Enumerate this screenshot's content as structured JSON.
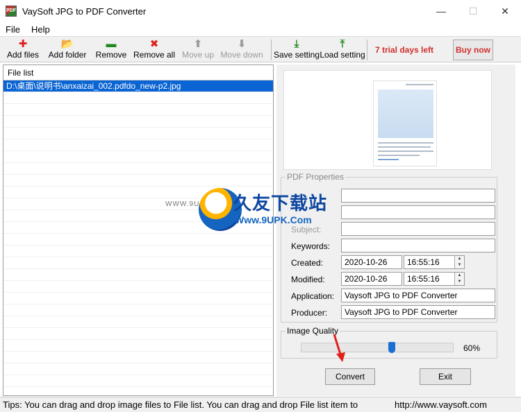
{
  "window": {
    "title": "VaySoft JPG to PDF Converter",
    "app_icon_text": "PDF",
    "minimize": "—",
    "maximize": "☐",
    "close": "✕"
  },
  "menu": {
    "items": [
      "File",
      "Help"
    ]
  },
  "toolbar": {
    "add_files": "Add files",
    "add_folder": "Add folder",
    "remove": "Remove",
    "remove_all": "Remove all",
    "move_up": "Move up",
    "move_down": "Move down",
    "save_setting": "Save setting",
    "load_setting": "Load setting",
    "trial": "7 trial days left",
    "buy_now": "Buy now",
    "colors": {
      "add": "#e02020",
      "remove": "#1e8a1e",
      "remove_all": "#e02020",
      "disabled": "#9a9a9a",
      "setting": "#1e8a1e"
    }
  },
  "file_list": {
    "header": "File list",
    "items": [
      "D:\\桌面\\说明书\\anxaizai_002.pdfdo_new-p2.jpg"
    ]
  },
  "preview": {},
  "pdf_properties": {
    "title": "PDF Properties",
    "subject_label": "Subject:",
    "keywords_label": "Keywords:",
    "created_label": "Created:",
    "created_date": "2020-10-26",
    "created_time": "16:55:16",
    "modified_label": "Modified:",
    "modified_date": "2020-10-26",
    "modified_time": "16:55:16",
    "application_label": "Application:",
    "application_value": "Vaysoft JPG to PDF Converter",
    "producer_label": "Producer:",
    "producer_value": "Vaysoft JPG to PDF Converter"
  },
  "image_quality": {
    "title": "Image Quality",
    "value": 60,
    "value_text": "60%"
  },
  "buttons": {
    "convert": "Convert",
    "exit": "Exit"
  },
  "status": {
    "tips": "Tips: You can drag and drop image files to File list. You can drag and drop File list item to",
    "url": "http://www.vaysoft.com"
  },
  "watermark": {
    "brand": "久友下载站",
    "url": "Www.9UPK.Com",
    "small": "WWW.9UPK.COM"
  }
}
